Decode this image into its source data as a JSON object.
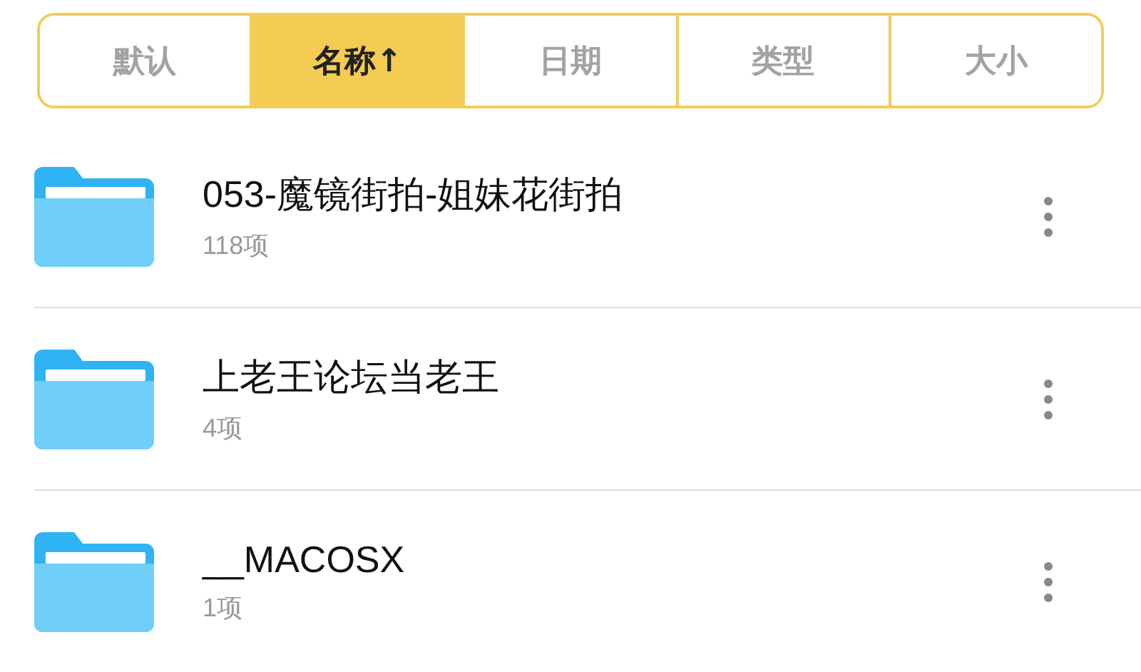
{
  "sort_tabs": [
    {
      "label": "默认",
      "selected": false
    },
    {
      "label": "名称↑",
      "selected": true
    },
    {
      "label": "日期",
      "selected": false
    },
    {
      "label": "类型",
      "selected": false
    },
    {
      "label": "大小",
      "selected": false
    }
  ],
  "files": [
    {
      "name": "053-魔镜街拍-姐妹花街拍",
      "count": "118项"
    },
    {
      "name": "上老王论坛当老王",
      "count": "4项"
    },
    {
      "name": "__MACOSX",
      "count": "1项"
    }
  ]
}
